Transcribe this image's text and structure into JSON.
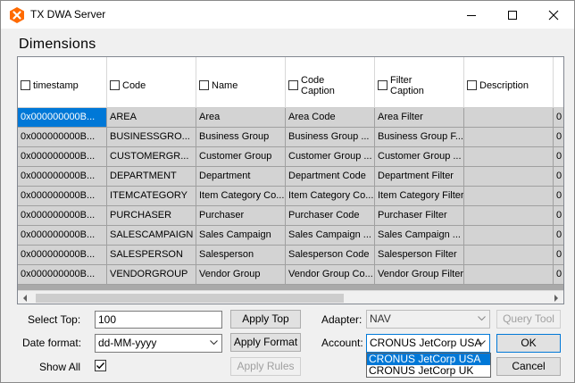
{
  "window": {
    "title": "TX DWA Server",
    "brand_color": "#ff6a00"
  },
  "panel": {
    "title": "Dimensions"
  },
  "grid": {
    "columns": [
      {
        "label": "timestamp"
      },
      {
        "label": "Code"
      },
      {
        "label": "Name"
      },
      {
        "label": "Code\nCaption"
      },
      {
        "label": "Filter\nCaption"
      },
      {
        "label": "Description"
      },
      {
        "label": ""
      }
    ],
    "rows": [
      [
        "0x000000000B...",
        "AREA",
        "Area",
        "Area Code",
        "Area Filter",
        "",
        "0"
      ],
      [
        "0x000000000B...",
        "BUSINESSGRO...",
        "Business Group",
        "Business Group ...",
        "Business Group F...",
        "",
        "0"
      ],
      [
        "0x000000000B...",
        "CUSTOMERGR...",
        "Customer Group",
        "Customer Group ...",
        "Customer Group ...",
        "",
        "0"
      ],
      [
        "0x000000000B...",
        "DEPARTMENT",
        "Department",
        "Department Code",
        "Department Filter",
        "",
        "0"
      ],
      [
        "0x000000000B...",
        "ITEMCATEGORY",
        "Item Category Co...",
        "Item Category Co...",
        "Item Category Filter",
        "",
        "0"
      ],
      [
        "0x000000000B...",
        "PURCHASER",
        "Purchaser",
        "Purchaser Code",
        "Purchaser Filter",
        "",
        "0"
      ],
      [
        "0x000000000B...",
        "SALESCAMPAIGN",
        "Sales Campaign",
        "Sales Campaign ...",
        "Sales Campaign ...",
        "",
        "0"
      ],
      [
        "0x000000000B...",
        "SALESPERSON",
        "Salesperson",
        "Salesperson Code",
        "Salesperson Filter",
        "",
        "0"
      ],
      [
        "0x000000000B...",
        "VENDORGROUP",
        "Vendor Group",
        "Vendor Group Co...",
        "Vendor Group Filter",
        "",
        "0"
      ]
    ],
    "selected_color": "#0078d7"
  },
  "controls": {
    "select_top_label": "Select Top:",
    "select_top_value": "100",
    "apply_top": "Apply Top",
    "date_format_label": "Date format:",
    "date_format_value": "dd-MM-yyyy",
    "apply_format": "Apply Format",
    "show_all_label": "Show All",
    "show_all_checked": true,
    "apply_rules": "Apply Rules",
    "adapter_label": "Adapter:",
    "adapter_value": "NAV",
    "query_tool": "Query Tool",
    "account_label": "Account:",
    "account_value": "CRONUS JetCorp USA",
    "ok": "OK",
    "cancel": "Cancel"
  },
  "account_dropdown": {
    "options": [
      "CRONUS JetCorp USA",
      "CRONUS JetCorp UK"
    ],
    "highlighted": 0
  },
  "icons": {
    "app": "dwa-app-icon",
    "minimize": "minimize-icon",
    "maximize": "maximize-icon",
    "close": "close-icon",
    "scroll_left": "scroll-left-arrow-icon",
    "scroll_right": "scroll-right-arrow-icon",
    "dropdown": "chevron-down-icon",
    "check": "checkmark-icon"
  }
}
